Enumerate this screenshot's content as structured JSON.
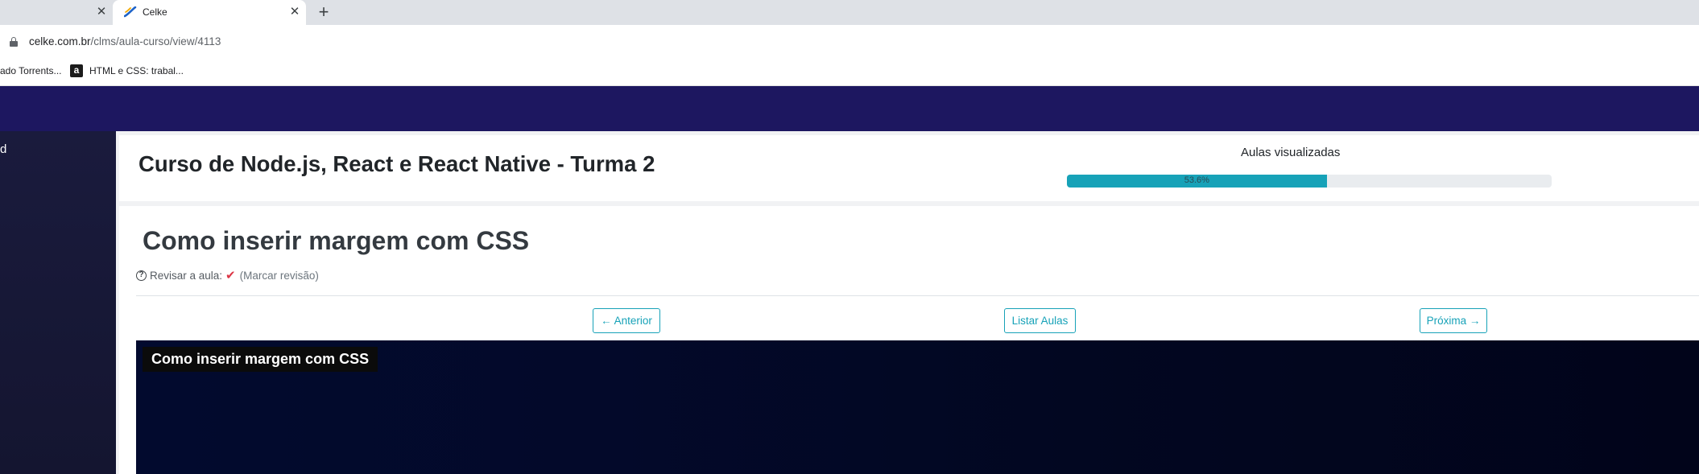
{
  "browser": {
    "tabs": [
      {
        "title": "",
        "close_glyph": "✕"
      },
      {
        "title": "Celke",
        "close_glyph": "✕",
        "active": true
      }
    ],
    "new_tab_glyph": "+",
    "url_domain": "celke.com.br",
    "url_path": "/clms/aula-curso/view/4113",
    "bookmarks": [
      {
        "label": "ado Torrents..."
      },
      {
        "label": "HTML e CSS: trabal...",
        "icon_letter": "a"
      }
    ]
  },
  "sidebar": {
    "items": [
      {
        "label": "d"
      }
    ]
  },
  "course": {
    "title": "Curso de Node.js, React e React Native - Turma 2",
    "progress_label": "Aulas visualizadas",
    "progress_percent": 53.6,
    "progress_text": "53.6%"
  },
  "lesson": {
    "title": "Como inserir margem com CSS",
    "review_label": "Revisar a aula:",
    "review_link": "(Marcar revisão)",
    "buttons": {
      "previous": "← Anterior",
      "list": "Listar Aulas",
      "next": "Próxima →"
    },
    "video_caption": "Como inserir margem com CSS"
  },
  "colors": {
    "topnav": "#1d1760",
    "accent": "#17a2b8",
    "check": "#dc3545"
  }
}
